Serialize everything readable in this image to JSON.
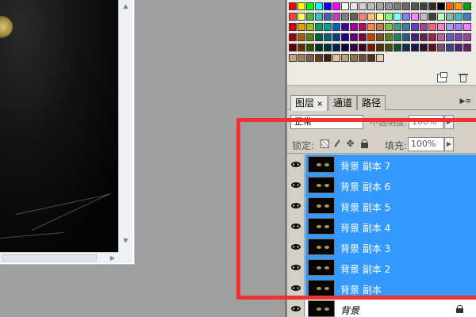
{
  "swatches": {
    "colors": [
      [
        "#ff0000",
        "#ffff00",
        "#00ff00",
        "#00ffff",
        "#0000ff",
        "#ff00ff",
        "#ffffff",
        "#e6e6e6",
        "#d0d0d0",
        "#bcbcbc",
        "#a6a6a6",
        "#929292",
        "#7c7c7c",
        "#686868",
        "#565656",
        "#404040",
        "#2c2c2c",
        "#000000",
        "#ff6000",
        "#ffa000",
        "#00a000"
      ],
      [
        "#ff4040",
        "#ffff60",
        "#40c040",
        "#40c0c0",
        "#4060c0",
        "#c040c0",
        "#808080",
        "#606060",
        "#ff8080",
        "#ffc080",
        "#ffff80",
        "#80ff80",
        "#80ffff",
        "#8080ff",
        "#ff80ff",
        "#c0c0c0",
        "#404040",
        "#c0ffc0",
        "#80c0a0",
        "#40c0c0",
        "#4080c0"
      ],
      [
        "#e00000",
        "#e0a000",
        "#a0c000",
        "#00a060",
        "#00a0a0",
        "#0060c0",
        "#4000a0",
        "#a000a0",
        "#c00060",
        "#ff8040",
        "#c08040",
        "#80c040",
        "#40a080",
        "#4080a0",
        "#6040c0",
        "#a040a0",
        "#ff6080",
        "#ff80c0",
        "#a0a0ff",
        "#a080ff",
        "#ff80ff"
      ],
      [
        "#a00000",
        "#a06000",
        "#608000",
        "#006040",
        "#006080",
        "#004080",
        "#200080",
        "#600080",
        "#800040",
        "#c04000",
        "#805020",
        "#608020",
        "#208060",
        "#206080",
        "#402080",
        "#602060",
        "#a02040",
        "#c060a0",
        "#6060c0",
        "#8040c0",
        "#a040a0"
      ],
      [
        "#600000",
        "#603000",
        "#305000",
        "#003020",
        "#003040",
        "#002050",
        "#100040",
        "#300040",
        "#400020",
        "#702000",
        "#503010",
        "#405010",
        "#105030",
        "#103050",
        "#201050",
        "#301030",
        "#601020",
        "#805070",
        "#404080",
        "#502080",
        "#602060"
      ],
      [
        "#c0a080",
        "#a08060",
        "#806040",
        "#604020",
        "#402010",
        "#e0c0a0",
        "#c0a070",
        "#907050",
        "#705030",
        "#503020",
        "#e0d0b0"
      ]
    ]
  },
  "layers_panel": {
    "tabs": [
      {
        "label": "图层",
        "close": "×"
      },
      {
        "label": "通道"
      },
      {
        "label": "路径"
      }
    ],
    "menu_icon": "▶≡",
    "blend_mode": "正常",
    "opacity_label": "不透明度:",
    "opacity_value": "100%",
    "lock_label": "锁定:",
    "fill_label": "填充:",
    "fill_value": "100%",
    "layers": [
      {
        "name": "背景 副本 7",
        "selected": true
      },
      {
        "name": "背景 副本 6",
        "selected": true
      },
      {
        "name": "背景 副本 5",
        "selected": true
      },
      {
        "name": "背景 副本 4",
        "selected": true
      },
      {
        "name": "背景 副本 3",
        "selected": true
      },
      {
        "name": "背景 副本 2",
        "selected": true
      },
      {
        "name": "背景 副本",
        "selected": true
      },
      {
        "name": "背景",
        "selected": false,
        "locked": true
      }
    ]
  },
  "colors": {
    "selection": "#3399ff",
    "highlight": "#ee3333"
  }
}
